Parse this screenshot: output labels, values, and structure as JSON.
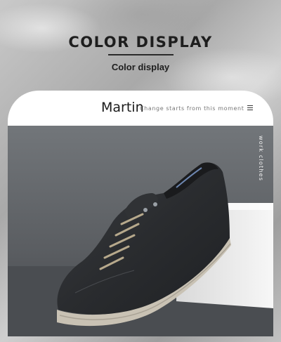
{
  "header": {
    "title": "COLOR DISPLAY",
    "subtitle": "Color display"
  },
  "card": {
    "brand": "Martin",
    "tagline": "Change starts from this moment",
    "menu_icon": "hamburger-menu-icon",
    "side_label": "work clothes"
  },
  "photo": {
    "subject": "shoe-image",
    "colors": {
      "shoe": "#2b2d30",
      "sole": "#c9c2b4",
      "laces": "#b7a98c",
      "backdrop": "#5e6165",
      "block": "#f0f0f0"
    }
  }
}
